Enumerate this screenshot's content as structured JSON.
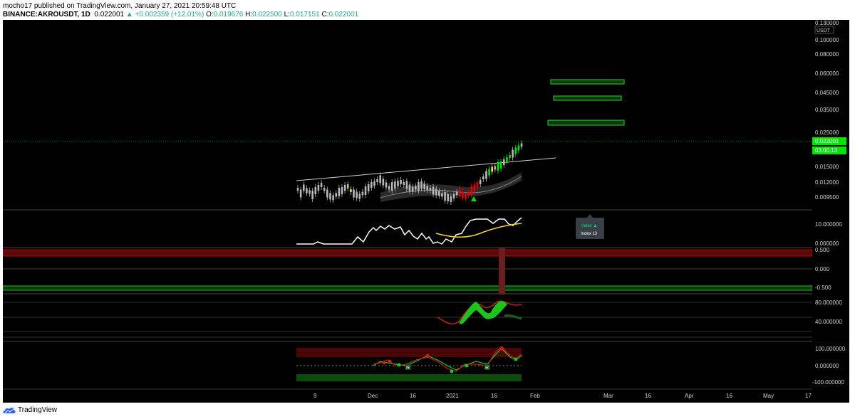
{
  "header": {
    "line1": "mocho17 published on TradingView.com, January 27, 2021 20:59:48 UTC",
    "symbol": "BINANCE:AKROUSDT, 1D",
    "last": "0.022001",
    "change": "▲ +0.002359 (+12.01%)",
    "o_label": "O:",
    "o": "0.019676",
    "h_label": "H:",
    "h": "0.022500",
    "l_label": "L:",
    "l": "0.017151",
    "c_label": "C:",
    "c": "0.022001"
  },
  "footer": {
    "brand": "TradingView"
  },
  "colors": {
    "up": "#26a69a",
    "down": "#ef5350",
    "bright_green": "#00e600",
    "red": "#e00000"
  },
  "price_axis": {
    "currency": "USDT",
    "top_label": "0.130000",
    "ticks": [
      "0.100000",
      "0.080000",
      "0.060000",
      "0.045000",
      "0.035000",
      "0.025000",
      "0.015000",
      "0.012000",
      "0.009500"
    ],
    "last_price": "0.022001",
    "countdown": "03:00:13"
  },
  "index_panel": {
    "ticks": [
      "10.000000",
      "0.000000"
    ],
    "tooltip_title": "Index ▲",
    "tooltip_sub": "Index 13"
  },
  "osc_panel": {
    "ticks": [
      "0.500",
      "0.000",
      "-0.500"
    ]
  },
  "stoch_panel": {
    "ticks": [
      "80.000000",
      "40.000000"
    ]
  },
  "rsi_panel": {
    "ticks": [
      "100.000000",
      "0.000000",
      "-100.000000"
    ],
    "marker": "R"
  },
  "time_axis": {
    "labels": [
      "9",
      "Dec",
      "16",
      "2021",
      "16",
      "Feb",
      "Mar",
      "16",
      "Apr",
      "16",
      "May",
      "17"
    ]
  },
  "chart_data": {
    "type": "candlestick",
    "symbol": "BINANCE:AKROUSDT",
    "interval": "1D",
    "ohlc_last": {
      "open": 0.019676,
      "high": 0.0225,
      "low": 0.017151,
      "close": 0.022001
    },
    "y_scale": "log",
    "target_zones": [
      {
        "low": 0.052,
        "high": 0.054
      },
      {
        "low": 0.042,
        "high": 0.044
      },
      {
        "low": 0.029,
        "high": 0.0305
      }
    ]
  }
}
